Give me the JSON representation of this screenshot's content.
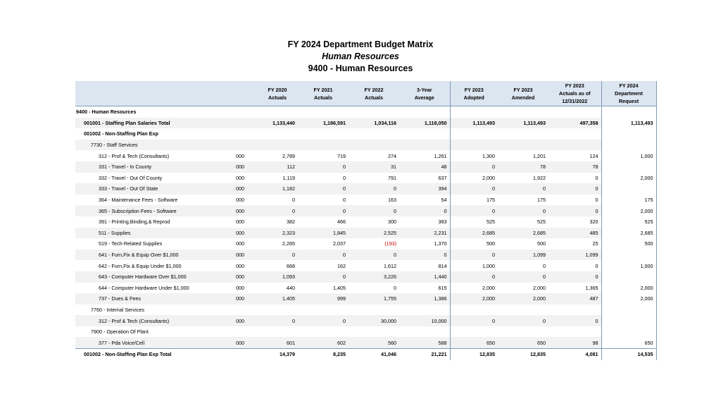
{
  "title": {
    "line1": "FY 2024 Department Budget Matrix",
    "line2": "Human Resources",
    "line3": "9400 - Human Resources"
  },
  "columns": [
    [
      "FY 2020",
      "Actuals"
    ],
    [
      "FY 2021",
      "Actuals"
    ],
    [
      "FY 2022",
      "Actuals"
    ],
    [
      "3-Year",
      "Average"
    ],
    [
      "FY 2023",
      "Adopted"
    ],
    [
      "FY 2023",
      "Amended"
    ],
    [
      "FY 2023",
      "Actuals as of",
      "12/31/2022"
    ],
    [
      "FY 2024",
      "Department",
      "Request"
    ]
  ],
  "rows": [
    {
      "label": "9400 - Human Resources",
      "level": 0,
      "bold": true,
      "code": "",
      "values": [
        "",
        "",
        "",
        "",
        "",
        "",
        "",
        ""
      ]
    },
    {
      "label": "001001 - Staffing Plan Salaries Total",
      "level": 1,
      "bold": true,
      "code": "",
      "values": [
        "1,133,440",
        "1,186,591",
        "1,034,116",
        "1,118,050",
        "1,113,493",
        "1,113,493",
        "497,358",
        "1,113,493"
      ]
    },
    {
      "label": "001002 - Non-Staffing Plan Exp",
      "level": 1,
      "bold": true,
      "code": "",
      "values": [
        "",
        "",
        "",
        "",
        "",
        "",
        "",
        ""
      ]
    },
    {
      "label": "7730 - Staff Services",
      "level": 2,
      "bold": false,
      "code": "",
      "values": [
        "",
        "",
        "",
        "",
        "",
        "",
        "",
        ""
      ]
    },
    {
      "label": "312 - Prof & Tech (Consultants)",
      "level": 3,
      "bold": false,
      "code": "000",
      "values": [
        "2,789",
        "719",
        "274",
        "1,261",
        "1,300",
        "1,201",
        "124",
        "1,000"
      ]
    },
    {
      "label": "331 - Travel - In County",
      "level": 3,
      "bold": false,
      "code": "000",
      "values": [
        "112",
        "0",
        "31",
        "48",
        "0",
        "78",
        "78",
        ""
      ]
    },
    {
      "label": "332 - Travel - Out Of County",
      "level": 3,
      "bold": false,
      "code": "000",
      "values": [
        "1,119",
        "0",
        "791",
        "637",
        "2,000",
        "1,922",
        "0",
        "2,000"
      ]
    },
    {
      "label": "333 - Travel - Out Of State",
      "level": 3,
      "bold": false,
      "code": "000",
      "values": [
        "1,182",
        "0",
        "0",
        "394",
        "0",
        "0",
        "0",
        ""
      ]
    },
    {
      "label": "364 - Maintenance Fees - Software",
      "level": 3,
      "bold": false,
      "code": "000",
      "values": [
        "0",
        "0",
        "163",
        "54",
        "175",
        "175",
        "0",
        "175"
      ]
    },
    {
      "label": "365 - Subscription Fees - Software",
      "level": 3,
      "bold": false,
      "code": "000",
      "values": [
        "0",
        "0",
        "0",
        "0",
        "0",
        "0",
        "0",
        "2,000"
      ]
    },
    {
      "label": "391 - Printing,Binding,& Reprod",
      "level": 3,
      "bold": false,
      "code": "000",
      "values": [
        "382",
        "466",
        "300",
        "383",
        "525",
        "525",
        "320",
        "525"
      ]
    },
    {
      "label": "511 - Supplies",
      "level": 3,
      "bold": false,
      "code": "000",
      "values": [
        "2,323",
        "1,845",
        "2,525",
        "2,231",
        "2,685",
        "2,685",
        "485",
        "2,685"
      ]
    },
    {
      "label": "519 - Tech-Related Supplies",
      "level": 3,
      "bold": false,
      "code": "000",
      "values": [
        "2,265",
        "2,037",
        "(193)",
        "1,370",
        "500",
        "500",
        "25",
        "500"
      ]
    },
    {
      "label": "641 - Furn,Fix & Equip Over $1,000",
      "level": 3,
      "bold": false,
      "code": "000",
      "values": [
        "0",
        "0",
        "0",
        "0",
        "0",
        "1,099",
        "1,099",
        ""
      ]
    },
    {
      "label": "642 - Furn,Fix & Equip Under $1,000",
      "level": 3,
      "bold": false,
      "code": "000",
      "values": [
        "668",
        "162",
        "1,612",
        "814",
        "1,000",
        "0",
        "0",
        "1,000"
      ]
    },
    {
      "label": "643 - Computer Hardware Over $1,000",
      "level": 3,
      "bold": false,
      "code": "000",
      "values": [
        "1,093",
        "0",
        "3,226",
        "1,440",
        "0",
        "0",
        "0",
        ""
      ]
    },
    {
      "label": "644 - Computer Hardware Under $1,000",
      "level": 3,
      "bold": false,
      "code": "000",
      "values": [
        "440",
        "1,405",
        "0",
        "615",
        "2,000",
        "2,000",
        "1,365",
        "2,000"
      ]
    },
    {
      "label": "737 - Dues & Fees",
      "level": 3,
      "bold": false,
      "code": "000",
      "values": [
        "1,405",
        "999",
        "1,755",
        "1,386",
        "2,000",
        "2,000",
        "487",
        "2,000"
      ]
    },
    {
      "label": "7760 - Internal Services",
      "level": 2,
      "bold": false,
      "code": "",
      "values": [
        "",
        "",
        "",
        "",
        "",
        "",
        "",
        ""
      ]
    },
    {
      "label": "312 - Prof & Tech (Consultants)",
      "level": 3,
      "bold": false,
      "code": "000",
      "values": [
        "0",
        "0",
        "30,000",
        "10,000",
        "0",
        "0",
        "0",
        ""
      ]
    },
    {
      "label": "7900 - Operation Of Plant",
      "level": 2,
      "bold": false,
      "code": "",
      "values": [
        "",
        "",
        "",
        "",
        "",
        "",
        "",
        ""
      ]
    },
    {
      "label": "377 - Pda Voice/Cell",
      "level": 3,
      "bold": false,
      "code": "000",
      "values": [
        "601",
        "602",
        "560",
        "588",
        "650",
        "650",
        "98",
        "650"
      ]
    },
    {
      "label": "001002 - Non-Staffing Plan Exp Total",
      "level": 1,
      "bold": true,
      "code": "",
      "values": [
        "14,379",
        "8,235",
        "41,046",
        "21,221",
        "12,835",
        "12,835",
        "4,081",
        "14,535"
      ]
    }
  ],
  "negative_color": "#c00000",
  "header_color": "#dce6f1",
  "band_color": "#f2f2f2"
}
